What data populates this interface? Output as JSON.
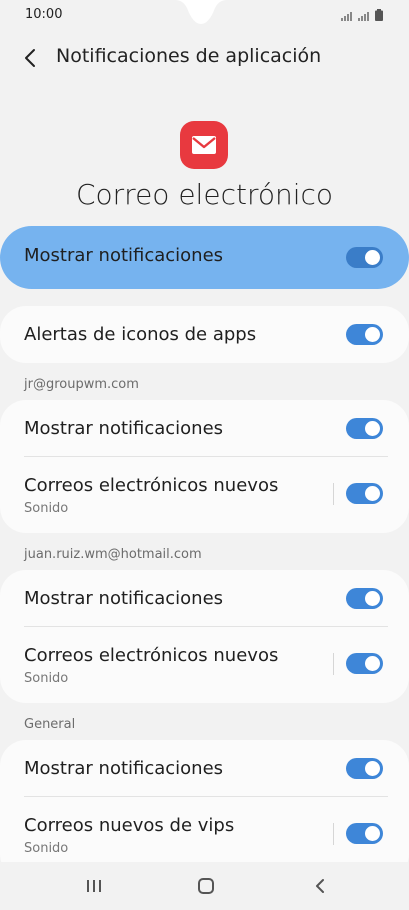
{
  "status": {
    "time": "10:00"
  },
  "header": {
    "title": "Notificaciones de aplicación"
  },
  "app": {
    "name": "Correo electrónico",
    "icon": "mail-icon",
    "accent": "#e8393f"
  },
  "master": {
    "label": "Mostrar notificaciones",
    "enabled": true
  },
  "badges": {
    "label": "Alertas de iconos de apps",
    "enabled": true
  },
  "sections": [
    {
      "header": "jr@groupwm.com",
      "rows": [
        {
          "label": "Mostrar notificaciones",
          "sub": "",
          "enabled": true
        },
        {
          "label": "Correos electrónicos nuevos",
          "sub": "Sonido",
          "enabled": true
        }
      ]
    },
    {
      "header": "juan.ruiz.wm@hotmail.com",
      "rows": [
        {
          "label": "Mostrar notificaciones",
          "sub": "",
          "enabled": true
        },
        {
          "label": "Correos electrónicos nuevos",
          "sub": "Sonido",
          "enabled": true
        }
      ]
    },
    {
      "header": "General",
      "rows": [
        {
          "label": "Mostrar notificaciones",
          "sub": "",
          "enabled": true
        },
        {
          "label": "Correos nuevos de vips",
          "sub": "Sonido",
          "enabled": true
        }
      ]
    }
  ],
  "colors": {
    "toggle_on": "#3e86d8",
    "master_bg": "#76b3ef",
    "background": "#f2f2f2"
  },
  "nav": {
    "recents": "recents-icon",
    "home": "home-icon",
    "back": "back-icon"
  }
}
